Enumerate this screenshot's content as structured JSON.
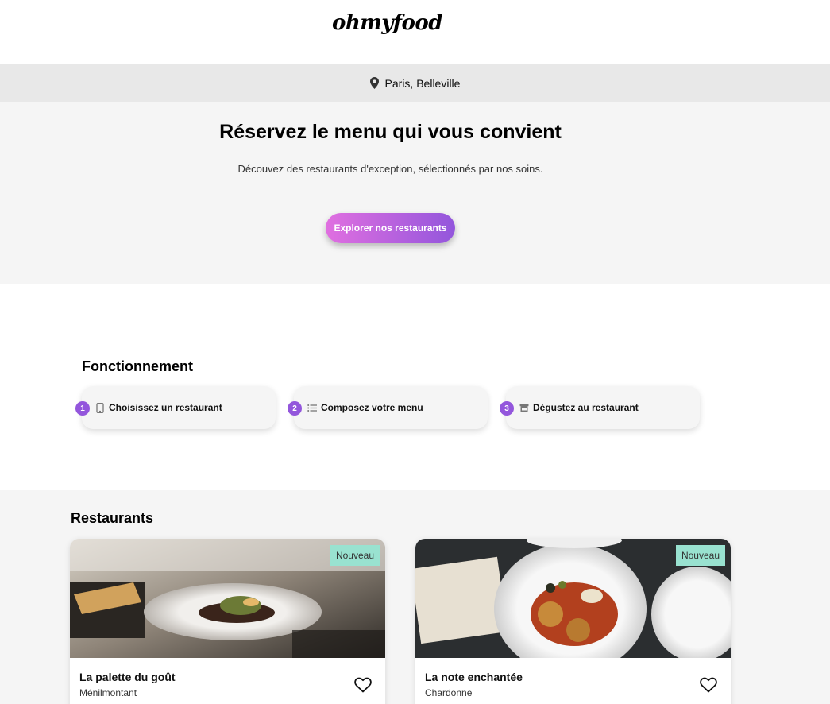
{
  "header": {
    "logo": "ohmyfood"
  },
  "location": {
    "text": "Paris, Belleville",
    "icon": "map-pin-icon"
  },
  "hero": {
    "title": "Réservez le menu qui vous convient",
    "subtitle": "Découvez des restaurants d'exception, sélectionnés par nos soins.",
    "cta_label": "Explorer nos restaurants"
  },
  "how": {
    "title": "Fonctionnement",
    "steps": [
      {
        "num": "1",
        "label": "Choisissez un restaurant",
        "icon": "smartphone-icon"
      },
      {
        "num": "2",
        "label": "Composez votre menu",
        "icon": "list-icon"
      },
      {
        "num": "3",
        "label": "Dégustez au restaurant",
        "icon": "store-icon"
      }
    ]
  },
  "restaurants": {
    "title": "Restaurants",
    "cards": [
      {
        "name": "La palette du goût",
        "location": "Ménilmontant",
        "badge": "Nouveau"
      },
      {
        "name": "La note enchantée",
        "location": "Chardonne",
        "badge": "Nouveau"
      }
    ]
  },
  "colors": {
    "accent_start": "#e06fe0",
    "accent_end": "#9356dc",
    "badge": "#99e2d0",
    "location_bar": "#e8e8e8",
    "section_bg": "#f5f5f5"
  }
}
